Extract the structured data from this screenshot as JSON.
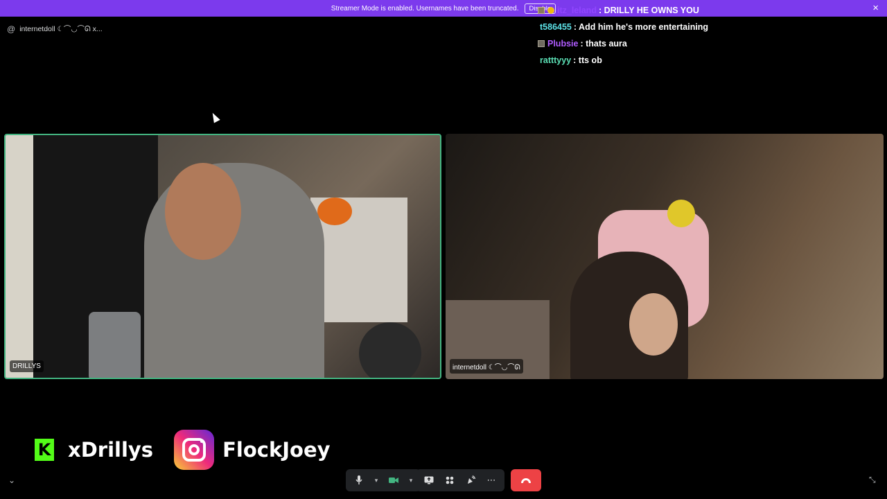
{
  "banner": {
    "message": "Streamer Mode is enabled. Usernames have been truncated.",
    "disable_label": "Disable",
    "close_icon": "×",
    "color": "#7c3aed"
  },
  "call": {
    "title": "internetdoll ☾⌒◡⌒ᘏ x..."
  },
  "chat": [
    {
      "user": "itz_leland",
      "text": ": DRILLY HE OWNS YOU",
      "user_color": "#9146ff",
      "badges": [
        "sub-badge",
        "coin-badge"
      ]
    },
    {
      "user": "t586455",
      "text": ": Add him he's more entertaining",
      "user_color": "#5ce1e6",
      "badges": []
    },
    {
      "user": "Plubsie",
      "text": ": thats aura",
      "user_color": "#b05cff",
      "badges": [
        "gift-badge"
      ]
    },
    {
      "user": "ratttyyy",
      "text": ": tts ob",
      "user_color": "#5ce1b6",
      "badges": []
    }
  ],
  "tiles": {
    "left_name": "DRILLYS",
    "right_name": "internetdoll ☾⌒◡⌒ᘏ"
  },
  "socials": {
    "kick_handle": "xDrillys",
    "instagram_handle": "FlockJoey",
    "kick_color": "#53fc18"
  },
  "controls": {
    "hangup_color": "#ed4245"
  }
}
